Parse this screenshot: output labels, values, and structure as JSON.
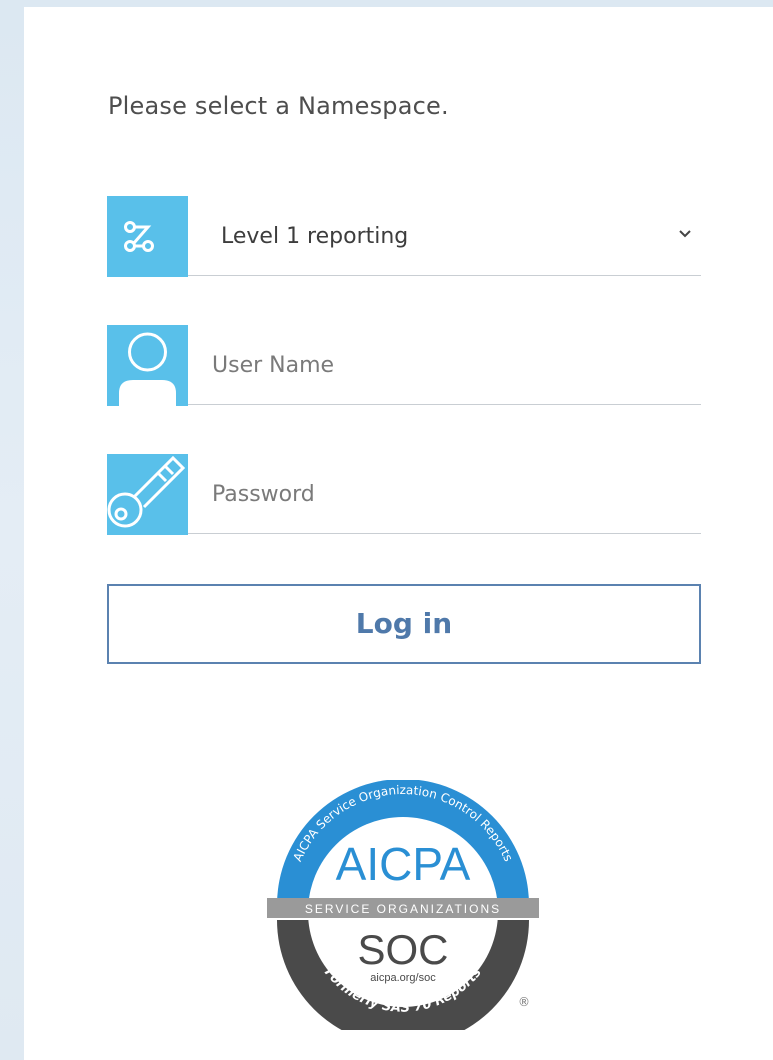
{
  "prompt": "Please select a Namespace.",
  "namespace": {
    "selected": "Level 1 reporting",
    "icon": "namespace-icon"
  },
  "username": {
    "placeholder": "User Name",
    "value": "",
    "icon": "user-icon"
  },
  "password": {
    "placeholder": "Password",
    "value": "",
    "icon": "key-icon"
  },
  "login_label": "Log in",
  "logo": {
    "arc_text": "AICPA Service Organization Control Reports",
    "name": "AICPA",
    "band": "SERVICE ORGANIZATIONS",
    "soc": "SOC",
    "url": "aicpa.org/soc",
    "bottom_text": "Formerly SAS 70 Reports",
    "mark": "®"
  },
  "colors": {
    "accent": "#59c0ea",
    "button": "#5b82b0",
    "logo_blue": "#2a8fd4",
    "logo_dark": "#4a4a4a"
  }
}
